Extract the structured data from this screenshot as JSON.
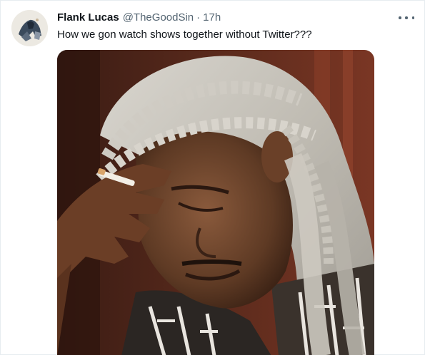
{
  "tweet": {
    "author_name": "Flank Lucas",
    "handle": "@TheGoodSin",
    "separator": "·",
    "time": "17h",
    "text": "How we gon watch shows together without Twitter???",
    "avatar_icon": "avatar-photo",
    "more_icon": "more-horizontal-icon",
    "media_description": "meme-photo"
  },
  "colors": {
    "primary_text": "#0f1419",
    "secondary_text": "#536471",
    "border": "#e6ecf0"
  }
}
